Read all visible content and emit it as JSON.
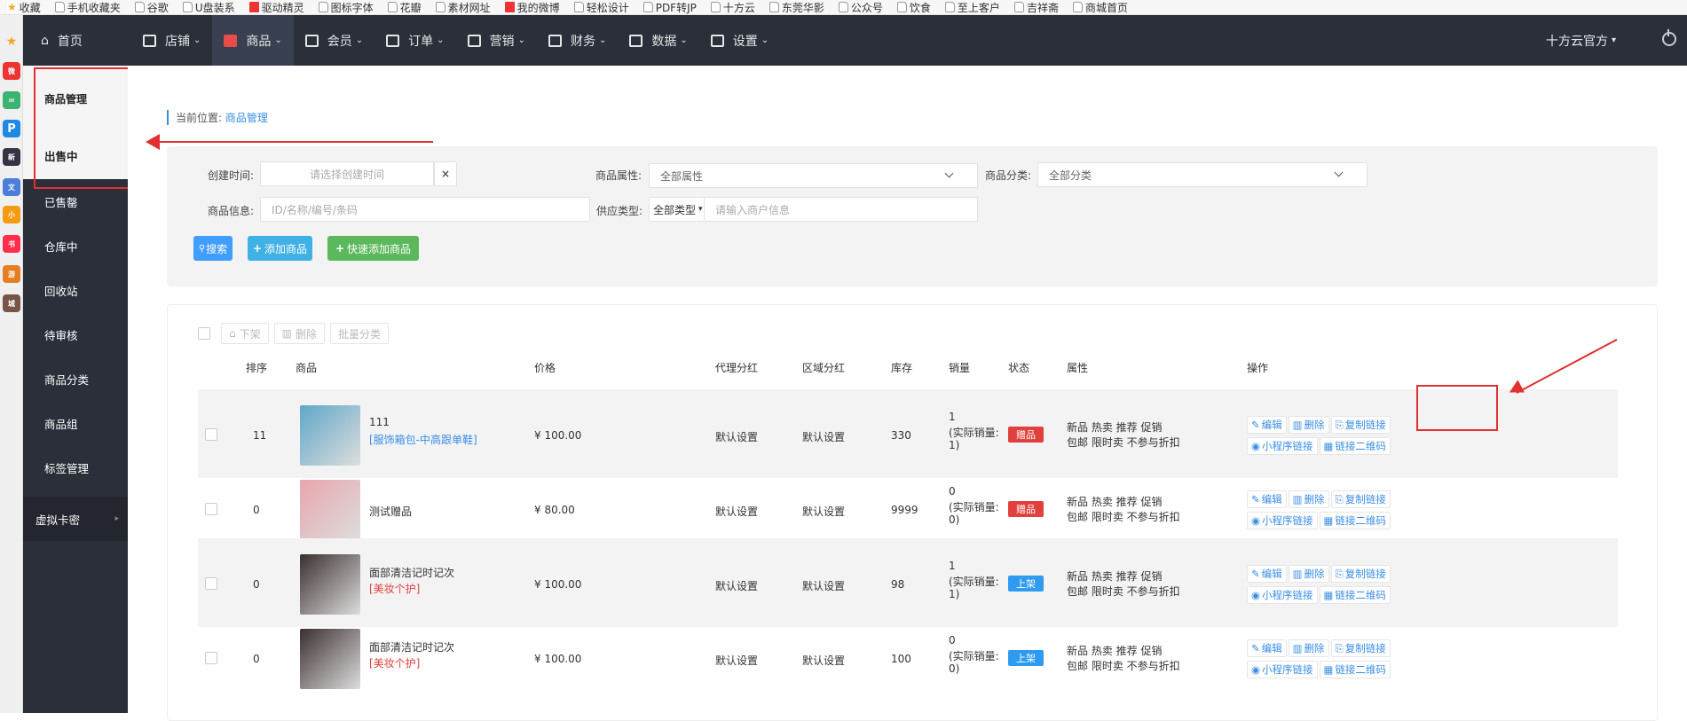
{
  "bookmarks": [
    "收藏",
    "手机收藏夹",
    "谷歌",
    "U盘装系",
    "驱动精灵",
    "图标字体",
    "花瓣",
    "素材网址",
    "我的微博",
    "轻松设计",
    "PDF转JP",
    "十方云",
    "东莞华影",
    "公众号",
    "饮食",
    "至上客户",
    "吉祥斋",
    "商城首页"
  ],
  "nav": {
    "home": "首页",
    "items": [
      {
        "label": "店铺",
        "active": false
      },
      {
        "label": "商品",
        "active": true
      },
      {
        "label": "会员",
        "active": false
      },
      {
        "label": "订单",
        "active": false
      },
      {
        "label": "营销",
        "active": false
      },
      {
        "label": "财务",
        "active": false
      },
      {
        "label": "数据",
        "active": false
      },
      {
        "label": "设置",
        "active": false
      }
    ],
    "account": "十方云官方"
  },
  "sidebar": {
    "header": "商品管理",
    "items": [
      "出售中",
      "已售罄",
      "仓库中",
      "回收站",
      "待审核",
      "商品分类",
      "商品组",
      "标签管理"
    ],
    "extra": "虚拟卡密"
  },
  "breadcrumb": {
    "prefix": "当前位置:",
    "current": "商品管理"
  },
  "filter": {
    "create_time_label": "创建时间:",
    "create_time_placeholder": "请选择创建时间",
    "clear": "×",
    "attr_label": "商品属性:",
    "attr_value": "全部属性",
    "category_label": "商品分类:",
    "category_value": "全部分类",
    "info_label": "商品信息:",
    "info_placeholder": "ID/名称/编号/条码",
    "supply_label": "供应类型:",
    "supply_value": "全部类型",
    "merchant_placeholder": "请输入商户信息",
    "search_btn": "搜索",
    "add_btn": "添加商品",
    "quick_add_btn": "快速添加商品"
  },
  "toolbar": {
    "off_shelf": "下架",
    "delete": "删除",
    "batch_category": "批量分类"
  },
  "columns": [
    "排序",
    "商品",
    "价格",
    "代理分红",
    "区域分红",
    "库存",
    "销量",
    "状态",
    "属性",
    "操作"
  ],
  "rows": [
    {
      "sort": "11",
      "name": "111",
      "tag": "[服饰箱包-中高跟单鞋]",
      "tag_color": "blue",
      "price": "¥ 100.00",
      "agent": "默认设置",
      "region": "默认设置",
      "stock": "330",
      "sales": "1",
      "sales_real_label": "(实际销量:",
      "sales_real": "1)",
      "status": "赠品",
      "status_color": "red",
      "attr1": "新品 热卖 推荐 促销",
      "attr2": "包邮 限时卖 不参与折扣",
      "thumb": "#5fa8c9"
    },
    {
      "sort": "0",
      "name": "测试赠品",
      "tag": "",
      "tag_color": "blue",
      "price": "¥ 80.00",
      "agent": "默认设置",
      "region": "默认设置",
      "stock": "9999",
      "sales": "0",
      "sales_real_label": "(实际销量:",
      "sales_real": "0)",
      "status": "赠品",
      "status_color": "red",
      "attr1": "新品 热卖 推荐 促销",
      "attr2": "包邮 限时卖 不参与折扣",
      "thumb": "#e8a6ad"
    },
    {
      "sort": "0",
      "name": "面部清洁记时记次",
      "tag": "[美妆个护]",
      "tag_color": "red",
      "price": "¥ 100.00",
      "agent": "默认设置",
      "region": "默认设置",
      "stock": "98",
      "sales": "1",
      "sales_real_label": "(实际销量:",
      "sales_real": "1)",
      "status": "上架",
      "status_color": "blue",
      "attr1": "新品 热卖 推荐 促销",
      "attr2": "包邮 限时卖 不参与折扣",
      "thumb": "#3b2f2f"
    },
    {
      "sort": "0",
      "name": "面部清洁记时记次",
      "tag": "[美妆个护]",
      "tag_color": "red",
      "price": "¥ 100.00",
      "agent": "默认设置",
      "region": "默认设置",
      "stock": "100",
      "sales": "0",
      "sales_real_label": "(实际销量:",
      "sales_real": "0)",
      "status": "上架",
      "status_color": "blue",
      "attr1": "新品 热卖 推荐 促销",
      "attr2": "包邮 限时卖 不参与折扣",
      "thumb": "#3b2f2f"
    }
  ],
  "ops": {
    "edit": "编辑",
    "delete": "删除",
    "copy_link": "复制链接",
    "mini_link": "小程序链接",
    "qr": "链接二维码"
  },
  "colors": {
    "nav_bg": "#2b2f3a",
    "accent": "#3a8ee6",
    "red": "#e03030"
  }
}
